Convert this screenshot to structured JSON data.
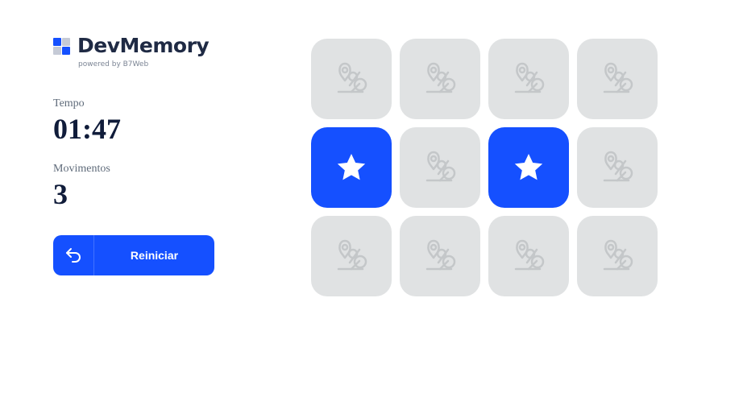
{
  "brand": {
    "name": "DevMemory",
    "tagline": "powered by B7Web",
    "accent_color": "#1550ff"
  },
  "stats": {
    "time_label": "Tempo",
    "time_value": "01:47",
    "moves_label": "Movimentos",
    "moves_value": "3"
  },
  "restart": {
    "label": "Reiniciar",
    "icon": "undo-icon"
  },
  "board": {
    "columns": 4,
    "rows": 3,
    "cards": [
      {
        "state": "hidden",
        "icon": "b7web-logo-icon"
      },
      {
        "state": "hidden",
        "icon": "b7web-logo-icon"
      },
      {
        "state": "hidden",
        "icon": "b7web-logo-icon"
      },
      {
        "state": "hidden",
        "icon": "b7web-logo-icon"
      },
      {
        "state": "revealed",
        "icon": "star-icon"
      },
      {
        "state": "hidden",
        "icon": "b7web-logo-icon"
      },
      {
        "state": "revealed",
        "icon": "star-icon"
      },
      {
        "state": "hidden",
        "icon": "b7web-logo-icon"
      },
      {
        "state": "hidden",
        "icon": "b7web-logo-icon"
      },
      {
        "state": "hidden",
        "icon": "b7web-logo-icon"
      },
      {
        "state": "hidden",
        "icon": "b7web-logo-icon"
      },
      {
        "state": "hidden",
        "icon": "b7web-logo-icon"
      }
    ]
  }
}
